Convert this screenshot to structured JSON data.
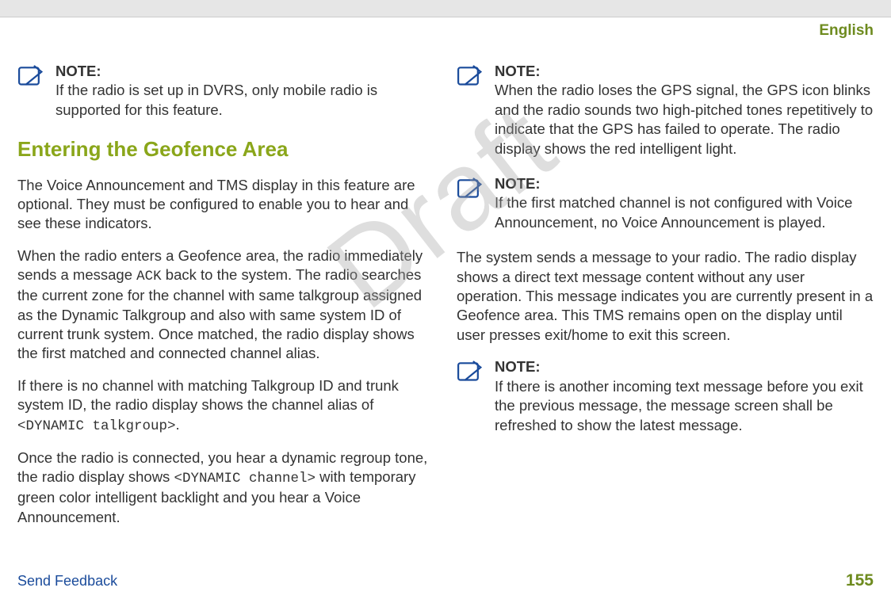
{
  "language_label": "English",
  "watermark": "Draft",
  "left": {
    "note1": {
      "label": "NOTE:",
      "text": "If the radio is set up in DVRS, only mobile radio is supported for this feature."
    },
    "heading": "Entering the Geofence Area",
    "p1": "The Voice Announcement and TMS display in this feature are optional. They must be configured to enable you to hear and see these indicators.",
    "p2a": "When the radio enters a Geofence area, the radio immediately sends a message ",
    "p2ack": "ACK",
    "p2b": " back to the system. The radio searches the current zone for the channel with same talkgroup assigned as the Dynamic Talkgroup and also with same system ID of current trunk system. Once matched, the radio display shows the first matched and connected channel alias.",
    "p3a": "If there is no channel with matching Talkgroup ID and trunk system ID, the radio display shows the channel alias of ",
    "p3code": "<DYNAMIC talkgroup>",
    "p3b": ".",
    "p4a": "Once the radio is connected, you hear a dynamic regroup tone, the radio display shows ",
    "p4code": "<DYNAMIC channel>",
    "p4b": " with temporary green color intelligent backlight and you hear a Voice Announcement."
  },
  "right": {
    "note1": {
      "label": "NOTE:",
      "text": "When the radio loses the GPS signal, the GPS icon blinks and the radio sounds two high-pitched tones repetitively to indicate that the GPS has failed to operate. The radio display shows the red intelligent light."
    },
    "note2": {
      "label": "NOTE:",
      "text": "If the first matched channel is not configured with Voice Announcement, no Voice Announcement is played."
    },
    "p1": "The system sends a message to your radio. The radio display shows a direct text message content without any user operation. This message indicates you are currently present in a Geofence area. This TMS remains open on the display until user presses exit/home to exit this screen.",
    "note3": {
      "label": "NOTE:",
      "text": "If there is another incoming text message before you exit the previous message, the message screen shall be refreshed to show the latest message."
    }
  },
  "footer": {
    "feedback": "Send Feedback",
    "page": "155"
  }
}
